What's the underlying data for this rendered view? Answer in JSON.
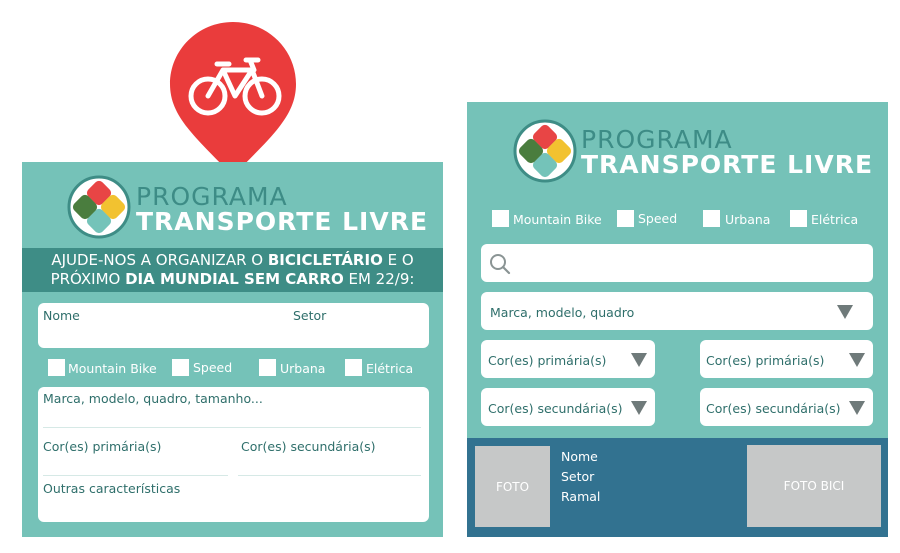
{
  "left_card": {
    "logo": {
      "line1": "PROGRAMA",
      "line2": "TRANSPORTE LIVRE"
    },
    "banner": {
      "line1_a": "AJUDE-NOS A ORGANIZAR O ",
      "line1_b": "BICICLETÁRIO",
      "line1_c": " E O",
      "line2_a": "PRÓXIMO ",
      "line2_b": "DIA MUNDIAL SEM CARRO",
      "line2_c": " EM 22/9:"
    },
    "name_label": "Nome",
    "sector_label": "Setor",
    "checkboxes": [
      "Mountain Bike",
      "Speed",
      "Urbana",
      "Elétrica"
    ],
    "brand_label": "Marca, modelo, quadro, tamanho...",
    "primary_color_label": "Cor(es) primária(s)",
    "secondary_color_label": "Cor(es) secundária(s)",
    "other_label": "Outras características"
  },
  "right_card": {
    "logo": {
      "line1": "PROGRAMA",
      "line2": "TRANSPORTE LIVRE"
    },
    "checkboxes": [
      "Mountain Bike",
      "Speed",
      "Urbana",
      "Elétrica"
    ],
    "search_placeholder": "",
    "brand_select": "Marca, modelo, quadro",
    "primary_left": "Cor(es) primária(s)",
    "primary_right": "Cor(es) primária(s)",
    "secondary_left": "Cor(es) secundária(s)",
    "secondary_right": "Cor(es) secundária(s)",
    "footer": {
      "photo": "FOTO",
      "name": "Nome",
      "sector": "Setor",
      "extension": "Ramal",
      "bike_photo": "FOTO BICI"
    }
  },
  "colors": {
    "card": "#75c2b8",
    "banner": "#3e8d86",
    "footer": "#327290",
    "pin": "#ea3c3c"
  },
  "icons": [
    "bicycle-icon",
    "search-icon",
    "chevron-down-icon"
  ]
}
